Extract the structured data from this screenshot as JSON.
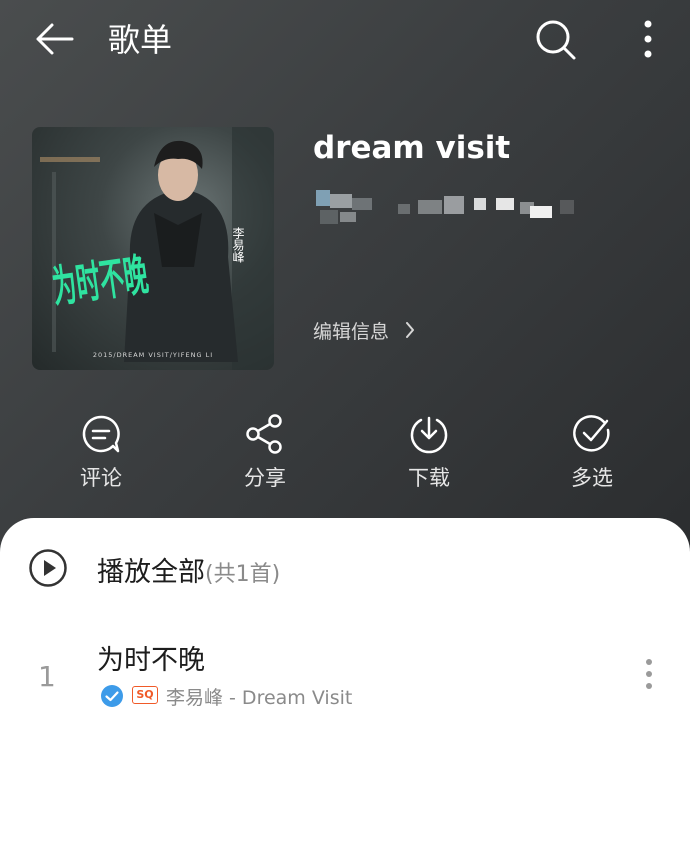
{
  "header": {
    "title": "歌单"
  },
  "playlist": {
    "title": "dream visit",
    "edit_label": "编辑信息",
    "cover_texts": [
      "为时不晚",
      "李易峰",
      "2015/DREAM VISIT/YIFENG LI"
    ]
  },
  "actions": [
    {
      "label": "评论",
      "icon": "comment-icon"
    },
    {
      "label": "分享",
      "icon": "share-icon"
    },
    {
      "label": "下载",
      "icon": "download-icon"
    },
    {
      "label": "多选",
      "icon": "multi-select-icon"
    }
  ],
  "play_all": {
    "label": "播放全部",
    "count": "(共1首)"
  },
  "tracks": [
    {
      "index": "1",
      "title": "为时不晚",
      "quality_badge": "SQ",
      "subtitle": "李易峰 - Dream Visit"
    }
  ],
  "colors": {
    "accent": "#f05a28",
    "verified": "#3d9be9",
    "header_bg": "#3b3e40"
  }
}
